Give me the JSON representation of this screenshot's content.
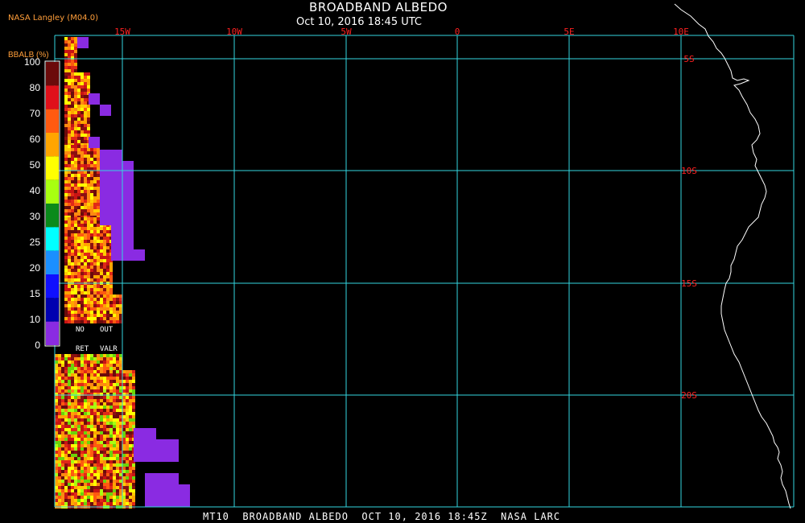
{
  "header": {
    "title": "BROADBAND ALBEDO",
    "subtitle": "Oct 10, 2016 18:45 UTC",
    "org": "NASA Langley (M04.0)"
  },
  "footer": {
    "text": "MT10  BROADBAND ALBEDO  OCT 10, 2016 18:45Z  NASA LARC"
  },
  "map": {
    "grid_color": "#33d6e0",
    "coast_color": "#ffffff",
    "longitudes": [
      {
        "label": "15W"
      },
      {
        "label": "10W"
      },
      {
        "label": "5W"
      },
      {
        "label": "0"
      },
      {
        "label": "5E"
      },
      {
        "label": "10E"
      }
    ],
    "latitudes": [
      {
        "label": "5S"
      },
      {
        "label": "10S"
      },
      {
        "label": "15S"
      },
      {
        "label": "20S"
      }
    ],
    "label_color": "#ff2020"
  },
  "colorbar": {
    "title": "BBALB (%)",
    "ticks": [
      "100",
      "80",
      "70",
      "60",
      "50",
      "40",
      "30",
      "25",
      "20",
      "15",
      "10",
      "0"
    ],
    "colors": [
      "#6b0b0b",
      "#e0101a",
      "#ff5a10",
      "#ffa500",
      "#ffff00",
      "#a8ff10",
      "#0a8a1a",
      "#00ffff",
      "#1a8fff",
      "#1010ff",
      "#0000b0",
      "#8a2be2"
    ],
    "no_ret_top": "NO",
    "no_ret_bottom": "RET",
    "out_valr_top": "OUT",
    "out_valr_bottom": "VALR"
  }
}
